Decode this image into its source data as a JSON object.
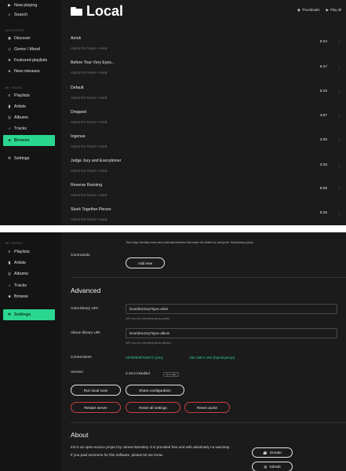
{
  "top": {
    "sidebar": {
      "nav": [
        {
          "icon": "play-icon",
          "glyph": "▶",
          "label": "Now playing"
        },
        {
          "icon": "search-icon",
          "glyph": "⌕",
          "label": "Search"
        }
      ],
      "discover_heading": "DISCOVER",
      "discover": [
        {
          "icon": "compass-icon",
          "glyph": "◉",
          "label": "Discover"
        },
        {
          "icon": "genre-icon",
          "glyph": "◇",
          "label": "Genre / Mood"
        },
        {
          "icon": "star-icon",
          "glyph": "★",
          "label": "Featured playlists"
        },
        {
          "icon": "new-releases-icon",
          "glyph": "●",
          "label": "New releases"
        }
      ],
      "music_heading": "MY MUSIC",
      "music": [
        {
          "icon": "playlist-icon",
          "glyph": "≡",
          "label": "Playlists"
        },
        {
          "icon": "artist-icon",
          "glyph": "▮",
          "label": "Artists"
        },
        {
          "icon": "album-icon",
          "glyph": "◎",
          "label": "Albums"
        },
        {
          "icon": "music-note-icon",
          "glyph": "♪",
          "label": "Tracks"
        },
        {
          "icon": "folder-icon",
          "glyph": "■",
          "label": "Browse",
          "active": true
        }
      ],
      "settings": {
        "icon": "gear-icon",
        "glyph": "✲",
        "label": "Settings"
      }
    },
    "title": "Local",
    "actions": {
      "thumbnails": {
        "glyph": "◉",
        "label": "Thumbnails"
      },
      "play_all": {
        "glyph": "▶",
        "label": "Play all"
      }
    },
    "tracks": [
      {
        "title": "Amok",
        "meta": "Atoms For Peace • Amok",
        "duration": "5:24"
      },
      {
        "title": "Before Your Very Eyes...",
        "meta": "Atoms For Peace • Amok",
        "duration": "5:47"
      },
      {
        "title": "Default",
        "meta": "Atoms For Peace • Amok",
        "duration": "5:15"
      },
      {
        "title": "Dropped",
        "meta": "Atoms For Peace • Amok",
        "duration": "4:57"
      },
      {
        "title": "Ingenue",
        "meta": "Atoms For Peace • Amok",
        "duration": "4:30"
      },
      {
        "title": "Judge Jury and Executioner",
        "meta": "Atoms For Peace • Amok",
        "duration": "3:28"
      },
      {
        "title": "Reverse Running",
        "meta": "Atoms For Peace • Amok",
        "duration": "5:06"
      },
      {
        "title": "Stuck Together Pieces",
        "meta": "Atoms For Peace • Amok",
        "duration": "5:26"
      }
    ],
    "more_glyph": "⋮"
  },
  "bottom": {
    "sidebar": {
      "music_heading": "MY MUSIC",
      "music": [
        {
          "icon": "playlist-icon",
          "glyph": "≡",
          "label": "Playlists"
        },
        {
          "icon": "artist-icon",
          "glyph": "▮",
          "label": "Artists"
        },
        {
          "icon": "album-icon",
          "glyph": "◎",
          "label": "Albums"
        },
        {
          "icon": "music-note-icon",
          "glyph": "♪",
          "label": "Tracks"
        },
        {
          "icon": "folder-icon",
          "glyph": "■",
          "label": "Browse"
        }
      ],
      "settings": {
        "icon": "gear-icon",
        "glyph": "✲",
        "label": "Settings",
        "active": true
      }
    },
    "notice": "This helps identify errors and potential features that make Iris better for everyone. Seeprivacy policy.",
    "commands": {
      "label": "Commands",
      "add_new": "Add new"
    },
    "advanced": {
      "title": "Advanced",
      "artist_uri": {
        "label": "Artist library URI",
        "value": "local:directory?type=artist",
        "hint": "URI used for collecting library artists"
      },
      "album_uri": {
        "label": "Album library URI",
        "value": "local:directory?type=album",
        "hint": "URI used for collecting library albums"
      },
      "connections": {
        "label": "Connections",
        "self": "15790849704974 (you)",
        "other": "192.168.0.162 (bqvokyaocp)"
      },
      "version": {
        "label": "Version",
        "value": "3.43.0 installed",
        "badge": "Up to date"
      },
      "buttons": {
        "local_scan": "Run local scan",
        "share_config": "Share configuration"
      },
      "danger": {
        "restart": "Restart server",
        "reset_settings": "Reset all settings",
        "reset_cache": "Reset cache"
      }
    },
    "about": {
      "title": "About",
      "line1": "Iris is an open-source project by James Barnsley. It is provided free and with absolutely no warranty.",
      "line2": "If you paid someone for this software, please let me know.",
      "donate": "Donate",
      "github": "GitHub",
      "donate_glyph": "☕",
      "github_glyph": "◍"
    }
  }
}
